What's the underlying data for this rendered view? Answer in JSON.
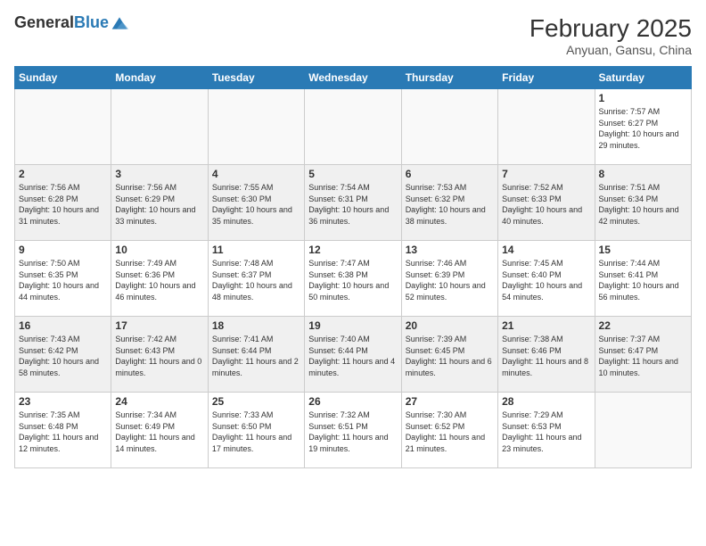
{
  "logo": {
    "general": "General",
    "blue": "Blue"
  },
  "header": {
    "month_year": "February 2025",
    "location": "Anyuan, Gansu, China"
  },
  "days_of_week": [
    "Sunday",
    "Monday",
    "Tuesday",
    "Wednesday",
    "Thursday",
    "Friday",
    "Saturday"
  ],
  "weeks": [
    [
      {
        "day": "",
        "info": ""
      },
      {
        "day": "",
        "info": ""
      },
      {
        "day": "",
        "info": ""
      },
      {
        "day": "",
        "info": ""
      },
      {
        "day": "",
        "info": ""
      },
      {
        "day": "",
        "info": ""
      },
      {
        "day": "1",
        "info": "Sunrise: 7:57 AM\nSunset: 6:27 PM\nDaylight: 10 hours and 29 minutes."
      }
    ],
    [
      {
        "day": "2",
        "info": "Sunrise: 7:56 AM\nSunset: 6:28 PM\nDaylight: 10 hours and 31 minutes."
      },
      {
        "day": "3",
        "info": "Sunrise: 7:56 AM\nSunset: 6:29 PM\nDaylight: 10 hours and 33 minutes."
      },
      {
        "day": "4",
        "info": "Sunrise: 7:55 AM\nSunset: 6:30 PM\nDaylight: 10 hours and 35 minutes."
      },
      {
        "day": "5",
        "info": "Sunrise: 7:54 AM\nSunset: 6:31 PM\nDaylight: 10 hours and 36 minutes."
      },
      {
        "day": "6",
        "info": "Sunrise: 7:53 AM\nSunset: 6:32 PM\nDaylight: 10 hours and 38 minutes."
      },
      {
        "day": "7",
        "info": "Sunrise: 7:52 AM\nSunset: 6:33 PM\nDaylight: 10 hours and 40 minutes."
      },
      {
        "day": "8",
        "info": "Sunrise: 7:51 AM\nSunset: 6:34 PM\nDaylight: 10 hours and 42 minutes."
      }
    ],
    [
      {
        "day": "9",
        "info": "Sunrise: 7:50 AM\nSunset: 6:35 PM\nDaylight: 10 hours and 44 minutes."
      },
      {
        "day": "10",
        "info": "Sunrise: 7:49 AM\nSunset: 6:36 PM\nDaylight: 10 hours and 46 minutes."
      },
      {
        "day": "11",
        "info": "Sunrise: 7:48 AM\nSunset: 6:37 PM\nDaylight: 10 hours and 48 minutes."
      },
      {
        "day": "12",
        "info": "Sunrise: 7:47 AM\nSunset: 6:38 PM\nDaylight: 10 hours and 50 minutes."
      },
      {
        "day": "13",
        "info": "Sunrise: 7:46 AM\nSunset: 6:39 PM\nDaylight: 10 hours and 52 minutes."
      },
      {
        "day": "14",
        "info": "Sunrise: 7:45 AM\nSunset: 6:40 PM\nDaylight: 10 hours and 54 minutes."
      },
      {
        "day": "15",
        "info": "Sunrise: 7:44 AM\nSunset: 6:41 PM\nDaylight: 10 hours and 56 minutes."
      }
    ],
    [
      {
        "day": "16",
        "info": "Sunrise: 7:43 AM\nSunset: 6:42 PM\nDaylight: 10 hours and 58 minutes."
      },
      {
        "day": "17",
        "info": "Sunrise: 7:42 AM\nSunset: 6:43 PM\nDaylight: 11 hours and 0 minutes."
      },
      {
        "day": "18",
        "info": "Sunrise: 7:41 AM\nSunset: 6:44 PM\nDaylight: 11 hours and 2 minutes."
      },
      {
        "day": "19",
        "info": "Sunrise: 7:40 AM\nSunset: 6:44 PM\nDaylight: 11 hours and 4 minutes."
      },
      {
        "day": "20",
        "info": "Sunrise: 7:39 AM\nSunset: 6:45 PM\nDaylight: 11 hours and 6 minutes."
      },
      {
        "day": "21",
        "info": "Sunrise: 7:38 AM\nSunset: 6:46 PM\nDaylight: 11 hours and 8 minutes."
      },
      {
        "day": "22",
        "info": "Sunrise: 7:37 AM\nSunset: 6:47 PM\nDaylight: 11 hours and 10 minutes."
      }
    ],
    [
      {
        "day": "23",
        "info": "Sunrise: 7:35 AM\nSunset: 6:48 PM\nDaylight: 11 hours and 12 minutes."
      },
      {
        "day": "24",
        "info": "Sunrise: 7:34 AM\nSunset: 6:49 PM\nDaylight: 11 hours and 14 minutes."
      },
      {
        "day": "25",
        "info": "Sunrise: 7:33 AM\nSunset: 6:50 PM\nDaylight: 11 hours and 17 minutes."
      },
      {
        "day": "26",
        "info": "Sunrise: 7:32 AM\nSunset: 6:51 PM\nDaylight: 11 hours and 19 minutes."
      },
      {
        "day": "27",
        "info": "Sunrise: 7:30 AM\nSunset: 6:52 PM\nDaylight: 11 hours and 21 minutes."
      },
      {
        "day": "28",
        "info": "Sunrise: 7:29 AM\nSunset: 6:53 PM\nDaylight: 11 hours and 23 minutes."
      },
      {
        "day": "",
        "info": ""
      }
    ]
  ]
}
